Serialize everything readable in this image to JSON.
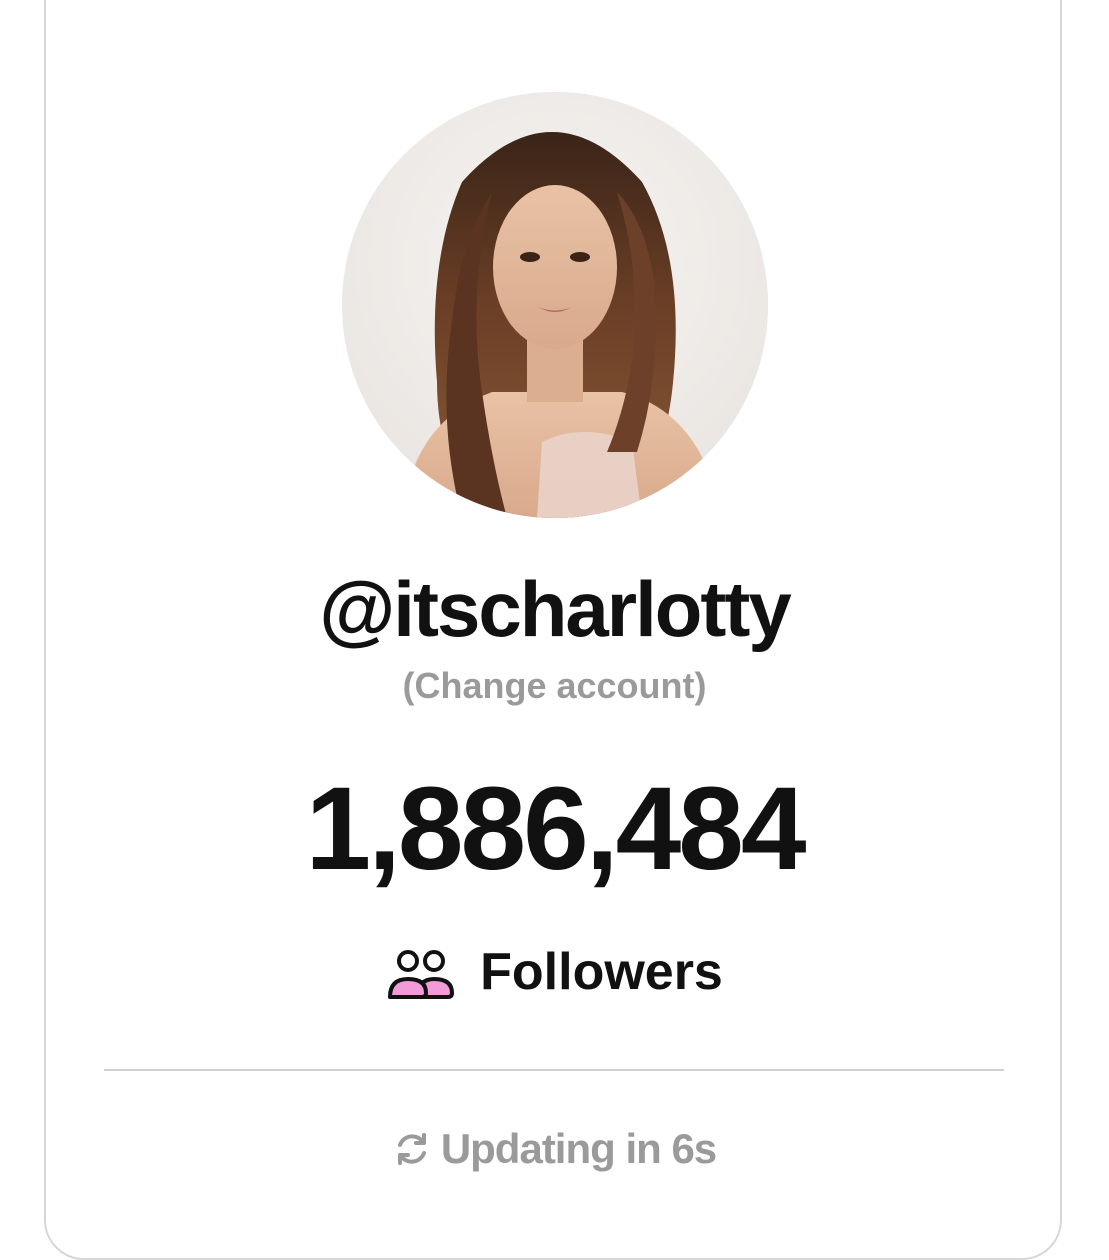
{
  "profile": {
    "username": "@itscharlotty",
    "change_account_label": "(Change account)",
    "avatar_icon": "profile-photo"
  },
  "stats": {
    "follower_count": "1,886,484",
    "followers_label": "Followers",
    "followers_icon": "people-icon"
  },
  "footer": {
    "updating_text": "Updating in 6s",
    "refresh_icon": "refresh-icon"
  },
  "colors": {
    "text_primary": "#111111",
    "text_muted": "#9a9a9a",
    "accent_pink": "#f29bd8",
    "border": "#d6d6d6"
  }
}
